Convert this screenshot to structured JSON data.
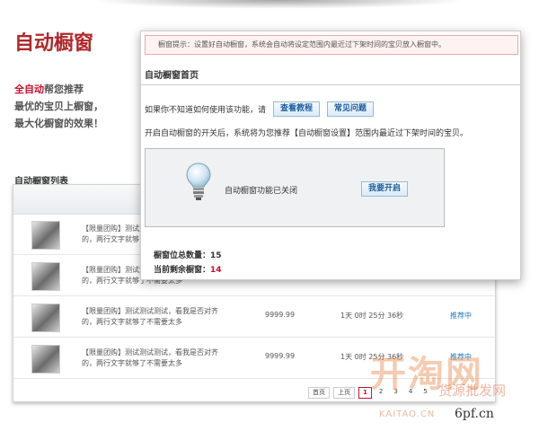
{
  "hero": {
    "title": "自动橱窗",
    "promo_highlight": "全自动",
    "promo_line1_rest": "帮您推荐",
    "promo_line2": "最优的宝贝上橱窗，",
    "promo_line3": "最大化橱窗的效果！"
  },
  "list": {
    "title": "自动橱窗列表",
    "rows": [
      {
        "desc": "【限量团购】测试测试测试，看我是否对齐的，两行文字就够了不需要太多",
        "price": "",
        "time": "",
        "status": ""
      },
      {
        "desc": "【限量团购】测试测试测试，看我是否对齐的，两行文字就够了不需要太多",
        "price": "",
        "time": "",
        "status": ""
      },
      {
        "desc": "【限量团购】测试测试测试，看我是否对齐的，两行文字就够了不需要太多",
        "price": "9999.99",
        "time": "1天 0时 25分 36秒",
        "status": "推荐中"
      },
      {
        "desc": "【限量团购】测试测试测试，看我是否对齐的，两行文字就够了不需要太多",
        "price": "9999.99",
        "time": "1天 0时 25分 36秒",
        "status": "推荐中"
      }
    ],
    "pager": {
      "first": "首页",
      "prev": "上页",
      "pages": [
        "1",
        "2",
        "3",
        "4",
        "5"
      ],
      "current": "1"
    }
  },
  "dialog": {
    "notice": "橱窗提示：设置好自动橱窗，系统会自动将设定范围内最近过下架时间的宝贝放入橱窗中。",
    "title": "自动橱窗首页",
    "help_text": "如果你不知道如何使用该功能，请",
    "tutorial_button": "查看教程",
    "faq_button": "常见问题",
    "description": "开启自动橱窗的开关后，系统将为您推荐【自动橱窗设置】范围内最近过下架时间的宝贝。",
    "status_text": "自动橱窗功能已关闭",
    "enable_button": "我要开启",
    "stat_total_label": "橱窗位总数量：",
    "stat_total_value": "15",
    "stat_remaining_label": "当前剩余橱窗：",
    "stat_remaining_value": "14"
  },
  "watermark": {
    "big": "开淘网",
    "sub": "货源批发网",
    "url": "KAITAO.CN",
    "site": "6pf.cn"
  }
}
